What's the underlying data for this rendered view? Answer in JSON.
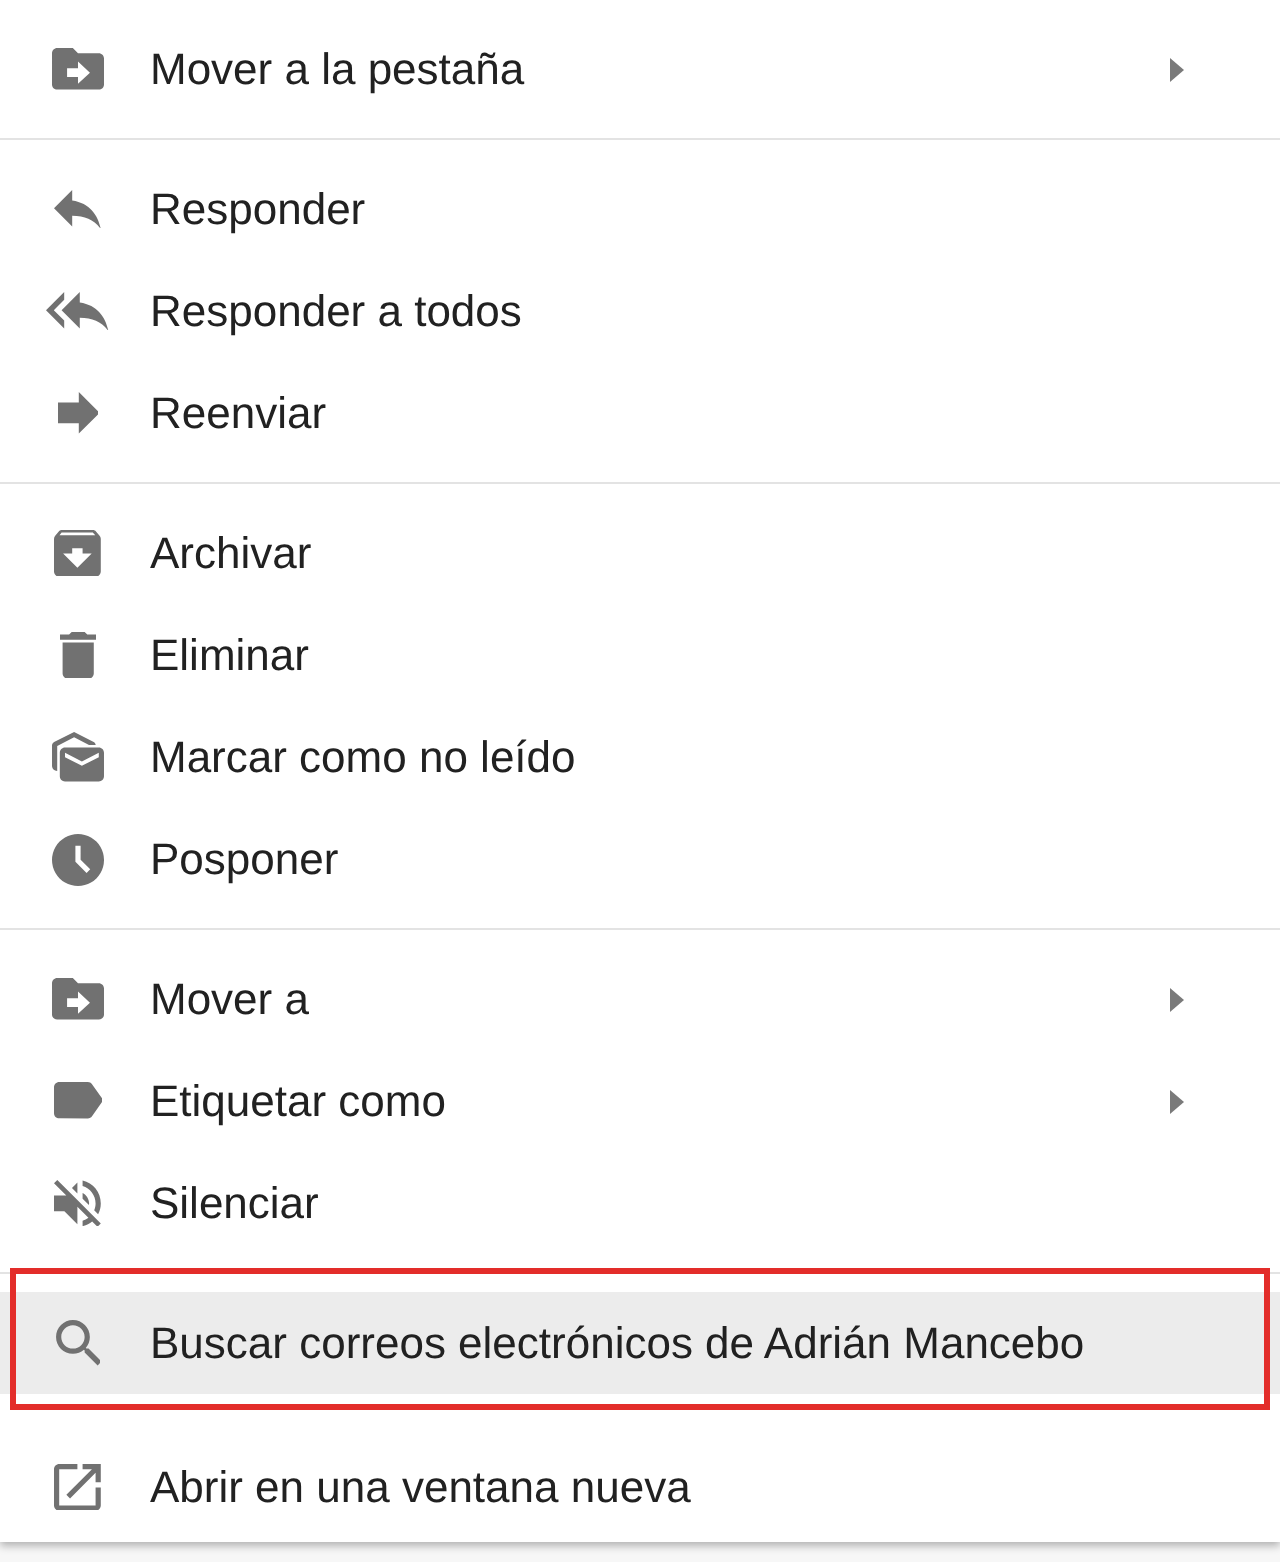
{
  "menu": {
    "sections": [
      {
        "items": [
          {
            "kind": "move",
            "label": "Mover a la pestaña",
            "submenu": true,
            "selected": false,
            "framed": false
          }
        ]
      },
      {
        "items": [
          {
            "kind": "reply",
            "label": "Responder",
            "submenu": false,
            "selected": false,
            "framed": false
          },
          {
            "kind": "replyall",
            "label": "Responder a todos",
            "submenu": false,
            "selected": false,
            "framed": false
          },
          {
            "kind": "forward",
            "label": "Reenviar",
            "submenu": false,
            "selected": false,
            "framed": false
          }
        ]
      },
      {
        "items": [
          {
            "kind": "archive",
            "label": "Archivar",
            "submenu": false,
            "selected": false,
            "framed": false
          },
          {
            "kind": "delete",
            "label": "Eliminar",
            "submenu": false,
            "selected": false,
            "framed": false
          },
          {
            "kind": "unread",
            "label": "Marcar como no leído",
            "submenu": false,
            "selected": false,
            "framed": false
          },
          {
            "kind": "snooze",
            "label": "Posponer",
            "submenu": false,
            "selected": false,
            "framed": false
          }
        ]
      },
      {
        "items": [
          {
            "kind": "move",
            "label": "Mover a",
            "submenu": true,
            "selected": false,
            "framed": false
          },
          {
            "kind": "label",
            "label": "Etiquetar como",
            "submenu": true,
            "selected": false,
            "framed": false
          },
          {
            "kind": "mute",
            "label": "Silenciar",
            "submenu": false,
            "selected": false,
            "framed": false
          }
        ]
      },
      {
        "items": [
          {
            "kind": "search",
            "label": "Buscar correos electrónicos de Adrián Mancebo",
            "submenu": false,
            "selected": true,
            "framed": true
          },
          {
            "kind": "popout",
            "label": "Abrir en una ventana nueva",
            "submenu": false,
            "selected": false,
            "framed": false
          }
        ]
      }
    ]
  }
}
